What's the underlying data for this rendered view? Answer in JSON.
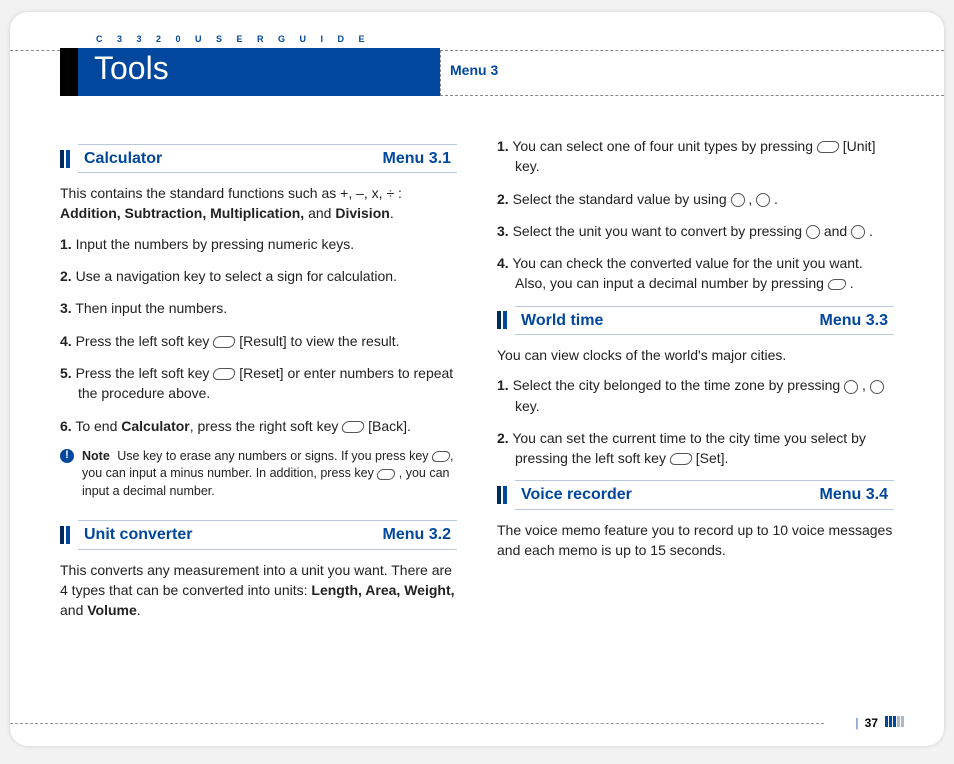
{
  "header": {
    "guide": "C 3 3 2 0   U S E R   G U I D E",
    "title": "Tools",
    "menu": "Menu 3"
  },
  "sections": {
    "calculator": {
      "title": "Calculator",
      "menu": "Menu 3.1",
      "intro_a": "This contains the standard functions such as +, –, x, ÷ : ",
      "intro_b": "Addition, Subtraction, Multiplication,",
      "intro_c": " and ",
      "intro_d": "Division",
      "intro_e": ".",
      "steps": [
        "Input the numbers by pressing numeric keys.",
        "Use a navigation key to select a sign for calculation.",
        "Then input the numbers.",
        "Press the left soft key  [Result] to view the result.",
        "Press the left soft key  [Reset] or enter numbers to repeat the procedure above.",
        "To end Calculator, press the right soft key  [Back]."
      ],
      "step4_before": "Press the left soft key ",
      "step4_after": " [Result] to view the result.",
      "step5_before": "Press the left soft key ",
      "step5_after": " [Reset] or enter numbers to repeat the procedure above.",
      "step6_before": "To end ",
      "step6_bold": "Calculator",
      "step6_mid": ", press the right soft key ",
      "step6_after": " [Back].",
      "note_label": "Note",
      "note_a": "Use key to erase any numbers or signs. If you press key ",
      "note_b": ", you can input a minus number. In addition, press key ",
      "note_c": " , you can input a decimal number."
    },
    "unit": {
      "title": "Unit converter",
      "menu": "Menu 3.2",
      "intro_a": "This converts any measurement into a unit you want. There are 4 types that can be converted into units: ",
      "intro_b": "Length, Area, Weight,",
      "intro_c": " and ",
      "intro_d": "Volume",
      "intro_e": ".",
      "s1_before": "You can select one of four unit types by pressing ",
      "s1_after": " [Unit] key.",
      "s2_before": "Select the standard value by using ",
      "s2_mid": " , ",
      "s2_after": " .",
      "s3_before": "Select the unit you want to convert by pressing ",
      "s3_mid": " and ",
      "s3_after": " .",
      "s4_before": "You can check the converted value for the unit you want. Also, you can input a decimal number by pressing ",
      "s4_after": " ."
    },
    "world": {
      "title": "World time",
      "menu": "Menu 3.3",
      "intro": "You can view clocks of the world's major cities.",
      "s1_before": "Select the city belonged to the time zone by pressing ",
      "s1_mid": " , ",
      "s1_after": " key.",
      "s2_before": "You can set the current time to the city time you select by pressing the left soft key ",
      "s2_after": " [Set]."
    },
    "voice": {
      "title": "Voice recorder",
      "menu": "Menu 3.4",
      "intro": "The voice memo feature you to record up to 10 voice messages and each memo is up to 15 seconds."
    }
  },
  "footer": {
    "page": "37"
  }
}
